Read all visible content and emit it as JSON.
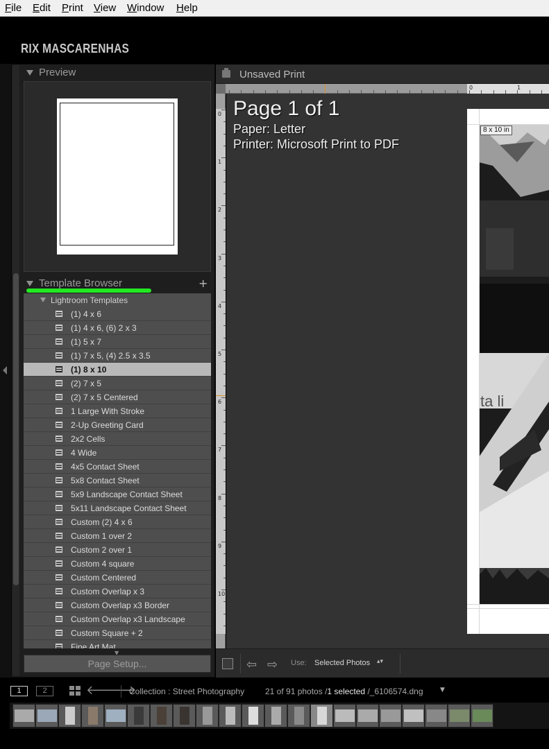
{
  "menubar": {
    "items": [
      {
        "mnemonic": "F",
        "rest": "ile"
      },
      {
        "mnemonic": "E",
        "rest": "dit"
      },
      {
        "mnemonic": "P",
        "rest": "rint"
      },
      {
        "mnemonic": "V",
        "rest": "iew"
      },
      {
        "mnemonic": "W",
        "rest": "indow"
      },
      {
        "mnemonic": "H",
        "rest": "elp"
      }
    ]
  },
  "identity_plate": "RIX MASCARENHAS",
  "left_panel": {
    "preview_title": "Preview",
    "template_browser_title": "Template Browser",
    "add_icon": "plus-icon",
    "group_label": "Lightroom Templates",
    "templates": [
      {
        "label": "(1) 4 x 6",
        "selected": false
      },
      {
        "label": "(1) 4 x 6, (6) 2 x 3",
        "selected": false
      },
      {
        "label": "(1) 5 x 7",
        "selected": false
      },
      {
        "label": "(1) 7 x 5, (4) 2.5 x 3.5",
        "selected": false
      },
      {
        "label": "(1) 8 x 10",
        "selected": true
      },
      {
        "label": "(2) 7 x 5",
        "selected": false
      },
      {
        "label": "(2) 7 x 5 Centered",
        "selected": false
      },
      {
        "label": "1 Large With Stroke",
        "selected": false
      },
      {
        "label": "2-Up Greeting Card",
        "selected": false
      },
      {
        "label": "2x2 Cells",
        "selected": false
      },
      {
        "label": "4 Wide",
        "selected": false
      },
      {
        "label": "4x5 Contact Sheet",
        "selected": false
      },
      {
        "label": "5x8 Contact Sheet",
        "selected": false
      },
      {
        "label": "5x9 Landscape Contact Sheet",
        "selected": false
      },
      {
        "label": "5x11 Landscape Contact Sheet",
        "selected": false
      },
      {
        "label": "Custom (2) 4 x 6",
        "selected": false
      },
      {
        "label": "Custom 1 over 2",
        "selected": false
      },
      {
        "label": "Custom 2 over 1",
        "selected": false
      },
      {
        "label": "Custom 4 square",
        "selected": false
      },
      {
        "label": "Custom Centered",
        "selected": false
      },
      {
        "label": "Custom Overlap x 3",
        "selected": false
      },
      {
        "label": "Custom Overlap x3 Border",
        "selected": false
      },
      {
        "label": "Custom Overlap x3 Landscape",
        "selected": false
      },
      {
        "label": "Custom Square + 2",
        "selected": false
      },
      {
        "label": "Fine Art Mat",
        "selected": false
      }
    ],
    "page_setup_label": "Page Setup..."
  },
  "center": {
    "title": "Unsaved Print",
    "page_info": {
      "title": "Page 1 of 1",
      "paper": "Paper:  Letter",
      "printer": "Printer:  Microsoft Print to PDF"
    },
    "cell_size_tag": "8 x 10 in",
    "photo_sign_text": "ta li",
    "ruler_left_numbers": [
      "0",
      "1",
      "2",
      "3",
      "4",
      "5",
      "6",
      "7",
      "8",
      "9",
      "10"
    ],
    "ruler_top_numbers": [
      "0",
      "1"
    ]
  },
  "toolbar": {
    "use_label": "Use:",
    "use_value": "Selected Photos"
  },
  "filmstrip_bar": {
    "screen1": "1",
    "screen2": "2",
    "collection": "Collection : Street Photography",
    "count_prefix": "21 of 91 photos /",
    "count_selected": "1 selected",
    "count_file": " /_6106574.dng"
  },
  "colors": {
    "accent_green": "#22e822",
    "ruler_marker": "#d9902a"
  }
}
